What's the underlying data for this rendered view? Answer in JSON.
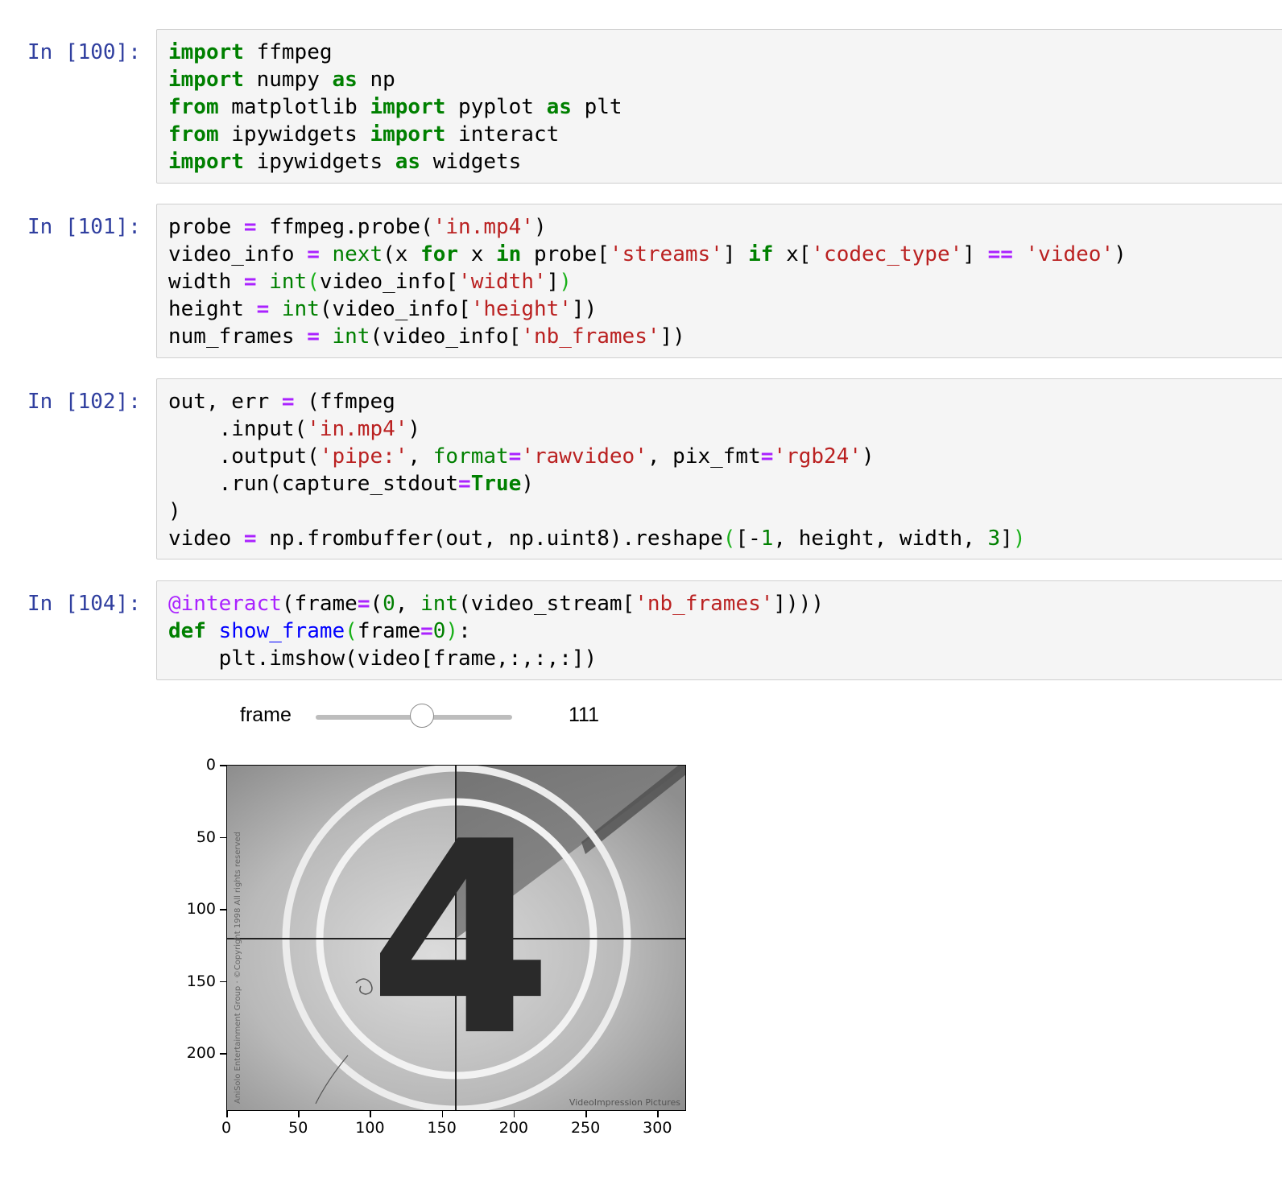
{
  "cells": [
    {
      "prompt": "In [100]:",
      "lines": [
        [
          [
            "k",
            "import"
          ],
          [
            "p",
            " ffmpeg"
          ]
        ],
        [
          [
            "k",
            "import"
          ],
          [
            "p",
            " numpy "
          ],
          [
            "k",
            "as"
          ],
          [
            "p",
            " np"
          ]
        ],
        [
          [
            "k",
            "from"
          ],
          [
            "p",
            " matplotlib "
          ],
          [
            "k",
            "import"
          ],
          [
            "p",
            " pyplot "
          ],
          [
            "k",
            "as"
          ],
          [
            "p",
            " plt"
          ]
        ],
        [
          [
            "k",
            "from"
          ],
          [
            "p",
            " ipywidgets "
          ],
          [
            "k",
            "import"
          ],
          [
            "p",
            " interact"
          ]
        ],
        [
          [
            "k",
            "import"
          ],
          [
            "p",
            " ipywidgets "
          ],
          [
            "k",
            "as"
          ],
          [
            "p",
            " widgets"
          ]
        ]
      ]
    },
    {
      "prompt": "In [101]:",
      "lines": [
        [
          [
            "p",
            "probe "
          ],
          [
            "o",
            "="
          ],
          [
            "p",
            " ffmpeg.probe("
          ],
          [
            "s",
            "'in.mp4'"
          ],
          [
            "p",
            ")"
          ]
        ],
        [
          [
            "p",
            "video_info "
          ],
          [
            "o",
            "="
          ],
          [
            "p",
            " "
          ],
          [
            "b",
            "next"
          ],
          [
            "p",
            "(x "
          ],
          [
            "k",
            "for"
          ],
          [
            "p",
            " x "
          ],
          [
            "k",
            "in"
          ],
          [
            "p",
            " probe["
          ],
          [
            "s",
            "'streams'"
          ],
          [
            "p",
            "] "
          ],
          [
            "k",
            "if"
          ],
          [
            "p",
            " x["
          ],
          [
            "s",
            "'codec_type'"
          ],
          [
            "p",
            "] "
          ],
          [
            "o",
            "=="
          ],
          [
            "p",
            " "
          ],
          [
            "s",
            "'video'"
          ],
          [
            "p",
            ")"
          ]
        ],
        [
          [
            "p",
            "width "
          ],
          [
            "o",
            "="
          ],
          [
            "p",
            " "
          ],
          [
            "b",
            "int"
          ],
          [
            "pg",
            "("
          ],
          [
            "p",
            "video_info["
          ],
          [
            "s",
            "'width'"
          ],
          [
            "p",
            "]"
          ],
          [
            "pg",
            ")"
          ]
        ],
        [
          [
            "p",
            "height "
          ],
          [
            "o",
            "="
          ],
          [
            "p",
            " "
          ],
          [
            "b",
            "int"
          ],
          [
            "p",
            "(video_info["
          ],
          [
            "s",
            "'height'"
          ],
          [
            "p",
            "])"
          ]
        ],
        [
          [
            "p",
            "num_frames "
          ],
          [
            "o",
            "="
          ],
          [
            "p",
            " "
          ],
          [
            "b",
            "int"
          ],
          [
            "p",
            "(video_info["
          ],
          [
            "s",
            "'nb_frames'"
          ],
          [
            "p",
            "])"
          ]
        ]
      ]
    },
    {
      "prompt": "In [102]:",
      "lines": [
        [
          [
            "p",
            "out, err "
          ],
          [
            "o",
            "="
          ],
          [
            "p",
            " (ffmpeg"
          ]
        ],
        [
          [
            "p",
            "    .input("
          ],
          [
            "s",
            "'in.mp4'"
          ],
          [
            "p",
            ")"
          ]
        ],
        [
          [
            "p",
            "    .output("
          ],
          [
            "s",
            "'pipe:'"
          ],
          [
            "p",
            ", "
          ],
          [
            "b",
            "format"
          ],
          [
            "o",
            "="
          ],
          [
            "s",
            "'rawvideo'"
          ],
          [
            "p",
            ", pix_fmt"
          ],
          [
            "o",
            "="
          ],
          [
            "s",
            "'rgb24'"
          ],
          [
            "p",
            ")"
          ]
        ],
        [
          [
            "p",
            "    .run(capture_stdout"
          ],
          [
            "o",
            "="
          ],
          [
            "k",
            "True"
          ],
          [
            "p",
            ")"
          ]
        ],
        [
          [
            "p",
            ")"
          ]
        ],
        [
          [
            "p",
            "video "
          ],
          [
            "o",
            "="
          ],
          [
            "p",
            " np.frombuffer(out, np.uint8).reshape"
          ],
          [
            "pg",
            "("
          ],
          [
            "p",
            "[-"
          ],
          [
            "n",
            "1"
          ],
          [
            "p",
            ", height, width, "
          ],
          [
            "n",
            "3"
          ],
          [
            "p",
            "]"
          ],
          [
            "pg",
            ")"
          ]
        ]
      ]
    },
    {
      "prompt": "In [104]:",
      "lines": [
        [
          [
            "d",
            "@interact"
          ],
          [
            "p",
            "(frame"
          ],
          [
            "o",
            "="
          ],
          [
            "p",
            "("
          ],
          [
            "n",
            "0"
          ],
          [
            "p",
            ", "
          ],
          [
            "b",
            "int"
          ],
          [
            "p",
            "(video_stream["
          ],
          [
            "s",
            "'nb_frames'"
          ],
          [
            "p",
            "])))"
          ]
        ],
        [
          [
            "k",
            "def"
          ],
          [
            "p",
            " "
          ],
          [
            "f",
            "show_frame"
          ],
          [
            "pg",
            "("
          ],
          [
            "p",
            "frame"
          ],
          [
            "o",
            "="
          ],
          [
            "n",
            "0"
          ],
          [
            "pg",
            ")"
          ],
          [
            "p",
            ":"
          ]
        ],
        [
          [
            "p",
            "    plt.imshow(video[frame,:,:,:])"
          ]
        ]
      ]
    }
  ],
  "widget": {
    "label": "frame",
    "value": "111",
    "value_fraction": 0.54
  },
  "chart_data": {
    "type": "image",
    "xticks": [
      "0",
      "50",
      "100",
      "150",
      "200",
      "250",
      "300"
    ],
    "yticks": [
      "0",
      "50",
      "100",
      "150",
      "200"
    ],
    "xlim": [
      0,
      320
    ],
    "ylim": [
      240,
      0
    ],
    "image_content": {
      "digit": "4",
      "watermark_bottom": "VideoImpression Pictures",
      "watermark_side": "AniSolo Entertainment Group · ©Copyright 1998 All rights reserved"
    }
  }
}
